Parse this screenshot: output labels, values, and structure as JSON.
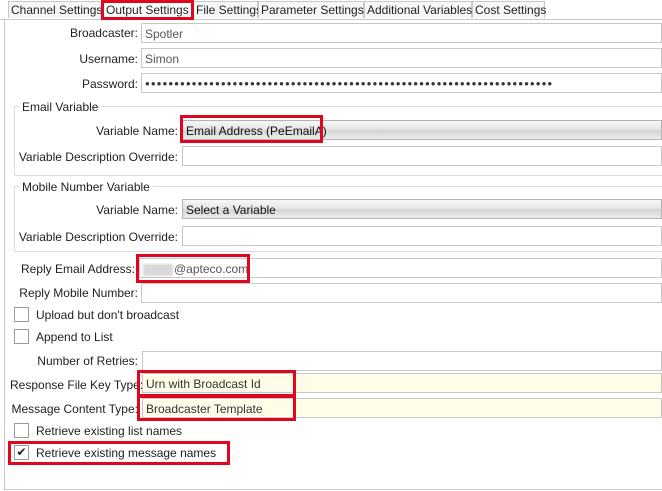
{
  "tabs": [
    "Channel Settings",
    "Output Settings",
    "File Settings",
    "Parameter Settings",
    "Additional Variables",
    "Cost Settings"
  ],
  "broadcaster": {
    "label": "Broadcaster:",
    "value": "Spotler"
  },
  "username": {
    "label": "Username:",
    "value": "Simon"
  },
  "password": {
    "label": "Password:",
    "value": "●●●●●●●●●●●●●●●●●●●●●●●●●●●●●●●●●●●●●●●●●●●●●●●●●●●●●●●●●●●●●●●●●●●●●●"
  },
  "email_group": {
    "title": "Email Variable",
    "variable_name_label": "Variable Name:",
    "variable_name_value": "Email Address (PeEmailA)",
    "desc_override_label": "Variable Description Override:",
    "desc_override_value": ""
  },
  "mobile_group": {
    "title": "Mobile Number Variable",
    "variable_name_label": "Variable Name:",
    "variable_name_value": "Select a Variable",
    "desc_override_label": "Variable Description Override:",
    "desc_override_value": ""
  },
  "reply_email": {
    "label": "Reply Email Address:",
    "value": "@apteco.com"
  },
  "reply_mobile": {
    "label": "Reply Mobile Number:",
    "value": ""
  },
  "upload_no_broadcast": {
    "label": "Upload but don't broadcast",
    "checked": false
  },
  "append_to_list": {
    "label": "Append to List",
    "checked": false
  },
  "retries": {
    "label": "Number of Retries:",
    "value": ""
  },
  "response_key": {
    "label": "Response File Key Type:",
    "value": "Urn with Broadcast Id"
  },
  "message_content": {
    "label": "Message Content Type:",
    "value": "Broadcaster Template"
  },
  "retrieve_list": {
    "label": "Retrieve existing list names",
    "checked": false
  },
  "retrieve_message": {
    "label": "Retrieve existing message names",
    "checked": true,
    "check_glyph": "✔"
  },
  "colors": {
    "highlight": "#e0061f",
    "field_bg_yellow": "#fffde8"
  }
}
